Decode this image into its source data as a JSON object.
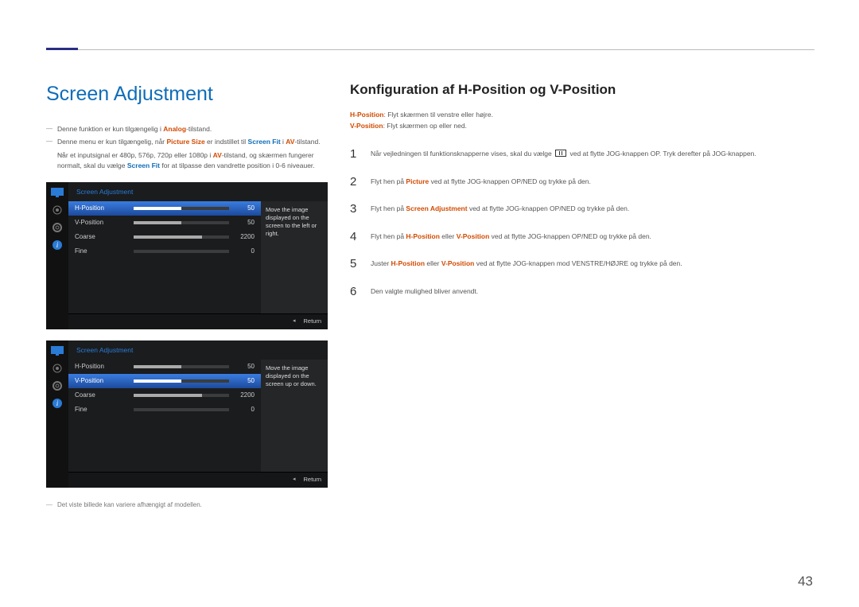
{
  "page_number": "43",
  "heading": "Screen Adjustment",
  "subtitle": "Konfiguration af H-Position og V-Position",
  "notes": {
    "n1_pre": "Denne funktion er kun tilgængelig i ",
    "n1_analog": "Analog",
    "n1_post": "-tilstand.",
    "n2_pre": "Denne menu er kun tilgængelig, når ",
    "n2_ps": "Picture Size",
    "n2_mid": " er indstillet til ",
    "n2_sf": "Screen Fit",
    "n2_mid2": " i ",
    "n2_av": "AV",
    "n2_post": "-tilstand.",
    "n2_sub_pre": "Når et inputsignal er 480p, 576p, 720p eller 1080p i ",
    "n2_sub_av": "AV",
    "n2_sub_mid": "-tilstand, og skærmen fungerer normalt, skal du vælge ",
    "n2_sub_sf": "Screen Fit",
    "n2_sub_post": " for at tilpasse den vandrette position i 0-6 niveauer."
  },
  "defs": {
    "hp_label": "H-Position",
    "hp_text": ": Flyt skærmen til venstre eller højre.",
    "vp_label": "V-Position",
    "vp_text": ": Flyt skærmen op eller ned."
  },
  "steps": [
    {
      "num": "1",
      "pre": "Når vejledningen til funktionsknapperne vises, skal du vælge ",
      "post": " ved at flytte JOG-knappen OP. Tryk derefter på JOG-knappen."
    },
    {
      "num": "2",
      "pre": "Flyt hen på ",
      "hl": "Picture",
      "post": " ved at flytte JOG-knappen OP/NED og trykke på den."
    },
    {
      "num": "3",
      "pre": "Flyt hen på ",
      "hl": "Screen Adjustment",
      "post": " ved at flytte JOG-knappen OP/NED og trykke på den."
    },
    {
      "num": "4",
      "pre": "Flyt hen på ",
      "hl": "H-Position",
      "mid": " eller ",
      "hl2": "V-Position",
      "post": " ved at flytte JOG-knappen OP/NED og trykke på den."
    },
    {
      "num": "5",
      "pre": "Juster ",
      "hl": "H-Position",
      "mid": " eller ",
      "hl2": "V-Position",
      "post": " ved at flytte JOG-knappen mod VENSTRE/HØJRE og trykke på den."
    },
    {
      "num": "6",
      "pre": "Den valgte mulighed bliver anvendt."
    }
  ],
  "osd": {
    "title": "Screen Adjustment",
    "return": "Return",
    "help_h": "Move the image displayed on the screen to the left or right.",
    "help_v": "Move the image displayed on the screen up or down.",
    "rows": [
      {
        "label": "H-Position",
        "value": "50",
        "fill": 50
      },
      {
        "label": "V-Position",
        "value": "50",
        "fill": 50
      },
      {
        "label": "Coarse",
        "value": "2200",
        "fill": 72
      },
      {
        "label": "Fine",
        "value": "0",
        "fill": 0
      }
    ]
  },
  "footnote": "Det viste billede kan variere afhængigt af modellen."
}
